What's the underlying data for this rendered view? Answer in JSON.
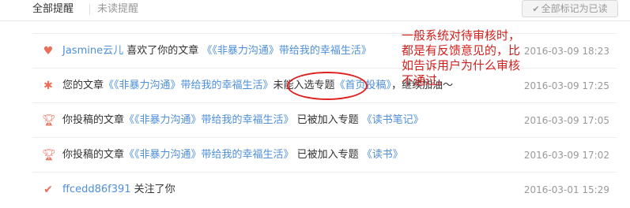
{
  "tabs": {
    "all_label": "全部提醒",
    "unread_label": "未读提醒"
  },
  "mark_all_button": "全部标记为已读",
  "notifications": [
    {
      "icon": "heart-icon",
      "user": "Jasmine云儿",
      "action": " 喜欢了你的文章 ",
      "article": "《《非暴力沟通》带给我的幸福生活》",
      "time": "2016-03-09 18:23"
    },
    {
      "icon": "bug-icon",
      "prefix": "您的文章",
      "article": "《《非暴力沟通》带给我的幸福生活》",
      "middle": "未能入选专题",
      "topic": "《首页投稿》",
      "suffix": "，继续加油～",
      "time": "2016-03-09 17:25"
    },
    {
      "icon": "trophy-icon",
      "prefix": "你投稿的文章",
      "article": "《《非暴力沟通》带给我的幸福生活》",
      "middle": " 已被加入专题 ",
      "topic": "《读书笔记》",
      "time": "2016-03-09 17:05"
    },
    {
      "icon": "trophy-icon",
      "prefix": "你投稿的文章",
      "article": "《《非暴力沟通》带给我的幸福生活》",
      "middle": " 已被加入专题 ",
      "topic": "《读书》",
      "time": "2016-03-09 17:02"
    },
    {
      "icon": "check-icon",
      "user": "ffcedd86f391",
      "action": " 关注了你",
      "time": "2016-03-01 15:29"
    }
  ],
  "annotation": {
    "text": "一般系统对待审核时，都是有反馈意见的，比如告诉用户为什么审核不通过。"
  },
  "colors": {
    "link": "#4e8fd8",
    "icon": "#ea6f5a",
    "annotation": "#d0201e"
  }
}
